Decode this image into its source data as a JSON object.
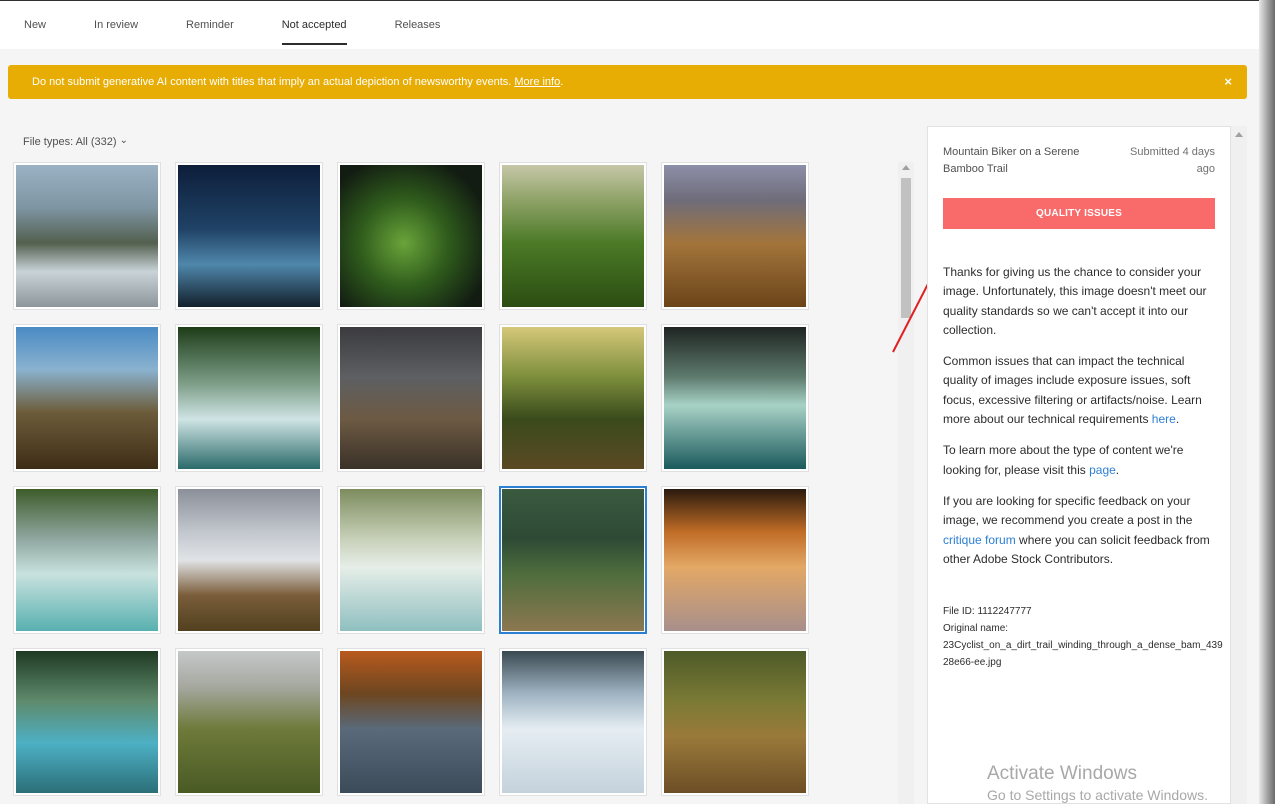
{
  "tabs": [
    {
      "label": "New"
    },
    {
      "label": "In review"
    },
    {
      "label": "Reminder"
    },
    {
      "label": "Not accepted",
      "active": true
    },
    {
      "label": "Releases"
    }
  ],
  "banner": {
    "text": "Do not submit generative AI content with titles that imply an actual depiction of newsworthy events.",
    "link": "More info",
    "link_suffix": ".",
    "close": "×",
    "color": "#e8ad04"
  },
  "filter": {
    "label": "File types: All (332)",
    "chevron": "⌄"
  },
  "grid": {
    "tiles": [
      {
        "name": "rafting",
        "bg": "linear-gradient(180deg,#9bb2c4 0%,#7e95a3 30%,#53604f 55%,#c9d3d8 75%,#8c969b 100%)",
        "selected": false
      },
      {
        "name": "night-tent",
        "bg": "linear-gradient(180deg,#0d1e3a 0%,#1f4266 45%,#4f87ab 70%,#13202c 100%)",
        "selected": false
      },
      {
        "name": "leaf",
        "bg": "radial-gradient(ellipse at 45% 55%,#6aa43a 0%,#2f5c1c 40%,#121c12 80%)",
        "selected": false
      },
      {
        "name": "green-hills",
        "bg": "linear-gradient(180deg,#c6c7a8 0%,#8ea267 25%,#4b7a26 55%,#2c4d12 100%)",
        "selected": false
      },
      {
        "name": "hill-runner",
        "bg": "linear-gradient(180deg,#8d8fa8 0%,#6f6c7a 25%,#a3753c 55%,#6b4418 100%)",
        "selected": false
      },
      {
        "name": "jeep",
        "bg": "linear-gradient(180deg,#4a8bc4 0%,#8ab2cf 30%,#6d5c3a 60%,#3e2d16 100%)",
        "selected": false
      },
      {
        "name": "waterfall-1",
        "bg": "linear-gradient(180deg,#1d3d18 0%,#7e9e89 40%,#cfe4e4 65%,#2b6a6a 100%)",
        "selected": false
      },
      {
        "name": "stone-path",
        "bg": "linear-gradient(180deg,#3b3b3f 0%,#5d5f63 35%,#6d5a43 65%,#3a3128 100%)",
        "selected": false
      },
      {
        "name": "rope-bridge",
        "bg": "linear-gradient(180deg,#d6c77a 0%,#7d8f3c 35%,#3a4a1c 65%,#5b4a24 100%)",
        "selected": false
      },
      {
        "name": "canyon",
        "bg": "linear-gradient(180deg,#1f2422 0%,#5d7a6d 35%,#a8d2c6 55%,#1b5a5d 100%)",
        "selected": false
      },
      {
        "name": "waterfall-2",
        "bg": "linear-gradient(180deg,#3d5c2a 0%,#8fa7a0 35%,#c8e2de 60%,#58b0b0 100%)",
        "selected": false
      },
      {
        "name": "misty-valley",
        "bg": "linear-gradient(180deg,#8a8f99 0%,#c2c6cd 30%,#e0e3e6 50%,#7a5d3a 75%,#51401f 100%)",
        "selected": false
      },
      {
        "name": "waterfall-3",
        "bg": "linear-gradient(180deg,#7d8c5e 0%,#c7d0b8 35%,#e6eee8 55%,#8fbfc0 100%)",
        "selected": false
      },
      {
        "name": "bamboo-biker",
        "bg": "linear-gradient(180deg,#3a5a3f 0%,#2e4a36 35%,#4f6d3d 60%,#8c7851 100%)",
        "selected": true
      },
      {
        "name": "sunset-footprints",
        "bg": "linear-gradient(180deg,#2a1a0e 0%,#c06c26 30%,#e3a866 55%,#a88f8b 100%)",
        "selected": false
      },
      {
        "name": "jungle-waterfall",
        "bg": "linear-gradient(180deg,#1e3a22 0%,#5f8a6c 35%,#4db0c4 65%,#2b6f78 100%)",
        "selected": false
      },
      {
        "name": "mountain-valley",
        "bg": "linear-gradient(180deg,#c4c8c8 0%,#a6a8a0 25%,#6d7a3a 55%,#4a5a24 100%)",
        "selected": false
      },
      {
        "name": "autumn-river",
        "bg": "linear-gradient(180deg,#b85a1e 0%,#6d4620 30%,#5a6a7a 55%,#3b4b5a 100%)",
        "selected": false
      },
      {
        "name": "snow-footprints",
        "bg": "linear-gradient(180deg,#3a4a52 0%,#9fb3c2 30%,#e5edf2 55%,#c4d2dc 100%)",
        "selected": false
      },
      {
        "name": "motion-biker",
        "bg": "linear-gradient(180deg,#4e5a28 0%,#7a7a35 35%,#9a7a3a 60%,#6d4e26 100%)",
        "selected": false
      }
    ]
  },
  "panel": {
    "title": "Mountain Biker on a Serene Bamboo Trail",
    "submitted": "Submitted 4 days ago",
    "badge": "QUALITY ISSUES",
    "badge_color": "#f96a6a",
    "p1": "Thanks for giving us the chance to consider your image. Unfortunately, this image doesn't meet our quality standards so we can't accept it into our collection.",
    "p2_pre": "Common issues that can impact the technical quality of images include exposure issues, soft focus, excessive filtering or artifacts/noise. Learn more about our technical requirements",
    "p2_link": "here",
    "p2_post": ".",
    "p3_pre": "To learn more about the type of content we're looking for, please visit this",
    "p3_link": "page",
    "p3_post": ".",
    "p4_pre": "If you are looking for specific feedback on your image, we recommend you create a post in the",
    "p4_link": "critique forum",
    "p4_post": "where you can solicit feedback from other Adobe Stock Contributors.",
    "file_id": "File ID: 1112247777",
    "original_name_label": "Original name:",
    "original_name": "23Cyclist_on_a_dirt_trail_winding_through_a_dense_bam_43928e66-ee.jpg"
  },
  "watermark": {
    "line1": "Activate Windows",
    "line2": "Go to Settings to activate Windows."
  },
  "annotation": {
    "color": "#e02020"
  }
}
